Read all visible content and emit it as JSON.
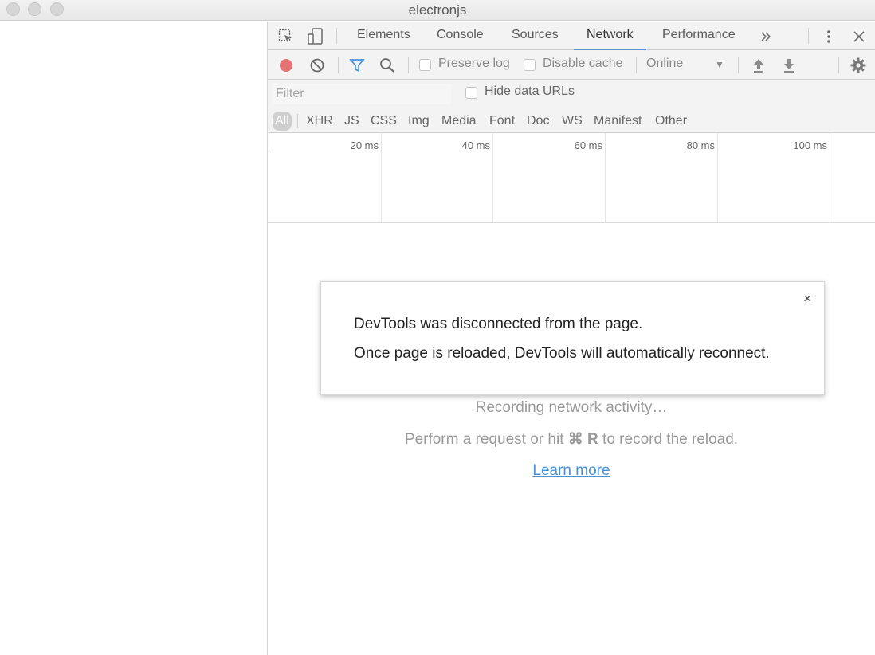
{
  "window": {
    "title": "electronjs"
  },
  "devtools": {
    "tabs": [
      "Elements",
      "Console",
      "Sources",
      "Network",
      "Performance"
    ],
    "active_tab": "Network",
    "more_tabs_icon": "double-chevron-right-icon",
    "toolbar": {
      "preserve_log": "Preserve log",
      "disable_cache": "Disable cache",
      "throttle_value": "Online"
    },
    "filter": {
      "placeholder": "Filter",
      "hide_data_urls": "Hide data URLs",
      "types": [
        "All",
        "XHR",
        "JS",
        "CSS",
        "Img",
        "Media",
        "Font",
        "Doc",
        "WS",
        "Manifest",
        "Other"
      ]
    },
    "timeline": {
      "ticks": [
        "20 ms",
        "40 ms",
        "60 ms",
        "80 ms",
        "100 ms"
      ]
    },
    "empty_state": {
      "recording": "Recording network activity…",
      "hint_prefix": "Perform a request or hit ",
      "hint_shortcut": "⌘ R",
      "hint_suffix": " to record the reload.",
      "learn_more": "Learn more"
    },
    "dialog": {
      "line1": "DevTools was disconnected from the page.",
      "line2": "Once page is reloaded, DevTools will automatically reconnect.",
      "close": "×"
    },
    "colors": {
      "record": "#e57373",
      "active_tab_underline": "#5f8fd6",
      "filter_icon": "#4a90d9",
      "link": "#4a90d9"
    }
  }
}
